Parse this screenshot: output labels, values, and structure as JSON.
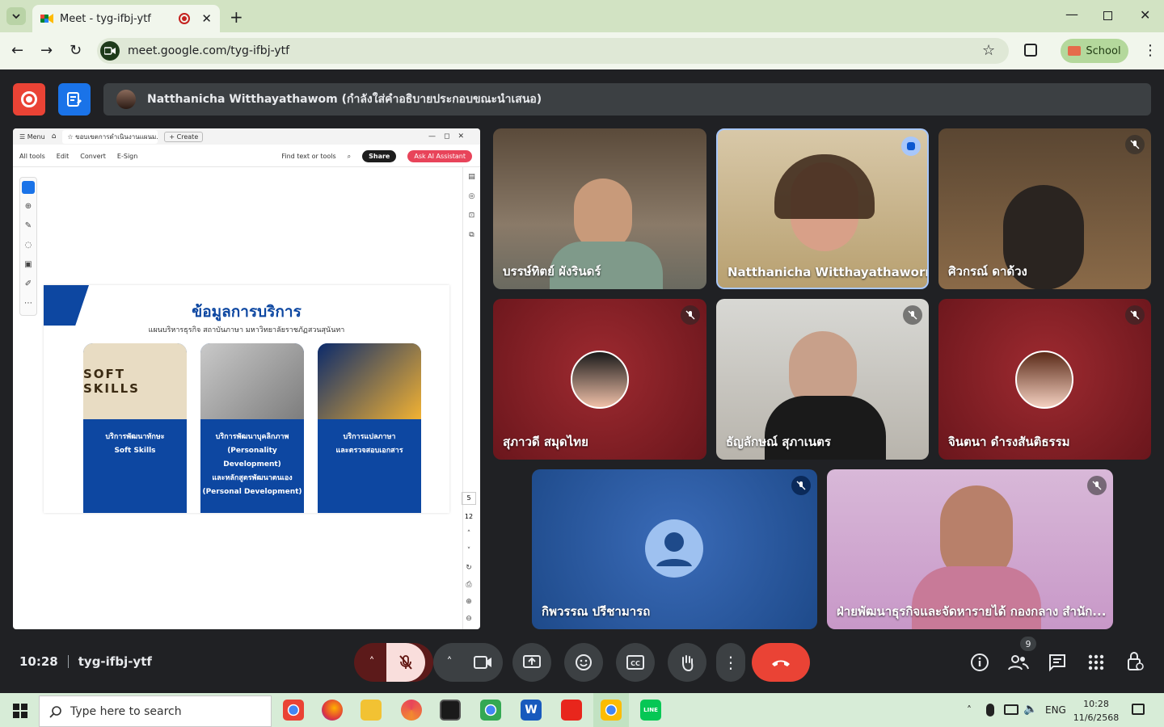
{
  "browser": {
    "tab_title": "Meet - tyg-ifbj-ytf",
    "url": "meet.google.com/tyg-ifbj-ytf",
    "profile_label": "School"
  },
  "meet": {
    "presenter_banner": "Natthanicha Witthayathawom (กำลังใส่คำอธิบายประกอบขณะนำเสนอ)",
    "time": "10:28",
    "meeting_code": "tyg-ifbj-ytf",
    "people_count": "9",
    "participants": [
      {
        "name": "บรรษ์ทิตย์ ผังรินดร์",
        "muted": false
      },
      {
        "name": "Natthanicha Witthayathaworn",
        "muted": false,
        "speaking": true
      },
      {
        "name": "ศิวกรณ์ ดาด้วง",
        "muted": true
      },
      {
        "name": "สุภาวดี สมุดไทย",
        "muted": true
      },
      {
        "name": "ธัญลักษณ์ สุภาเนตร",
        "muted": true
      },
      {
        "name": "จินตนา ดำรงสันติธรรม",
        "muted": true
      },
      {
        "name": "กิพวรรณ ปรีชามารถ",
        "muted": true
      },
      {
        "name": "ฝ่ายพัฒนาธุรกิจและจัดหารายได้ กองกลาง สำนัก...",
        "muted": true
      }
    ]
  },
  "doc": {
    "tab_title": "ขอบเขตการดำเนินงานแผนม...",
    "menu": "Menu",
    "create": "+ Create",
    "toolbar": [
      "All tools",
      "Edit",
      "Convert",
      "E-Sign"
    ],
    "find": "Find text or tools",
    "share": "Share",
    "ask_ai": "Ask AI Assistant",
    "page_current": "5",
    "page_total": "12",
    "slide": {
      "title": "ข้อมูลการบริการ",
      "subtitle": "แผนบริหารธุรกิจ สถาบันภาษา มหาวิทยาลัยราชภัฏสวนสุนันทา",
      "image_text": "SOFT SKILLS",
      "cards": [
        {
          "line1": "บริการพัฒนาทักษะ",
          "line2": "Soft Skills",
          "line3": "",
          "line4": ""
        },
        {
          "line1": "บริการพัฒนาบุคลิกภาพ",
          "line2": "(Personality Development)",
          "line3": "และหลักสูตรพัฒนาตนเอง",
          "line4": "(Personal Development)"
        },
        {
          "line1": "บริการแปลภาษา",
          "line2": "และตรวจสอบเอกสาร",
          "line3": "",
          "line4": ""
        }
      ]
    }
  },
  "taskbar": {
    "search_placeholder": "Type here to search",
    "lang": "ENG",
    "clock_time": "10:28",
    "clock_date": "11/6/2568"
  },
  "colors": {
    "meet_bg": "#202124",
    "end_call": "#ea4335",
    "mic_off": "#f9dedc",
    "doc_blue": "#0d47a1"
  }
}
